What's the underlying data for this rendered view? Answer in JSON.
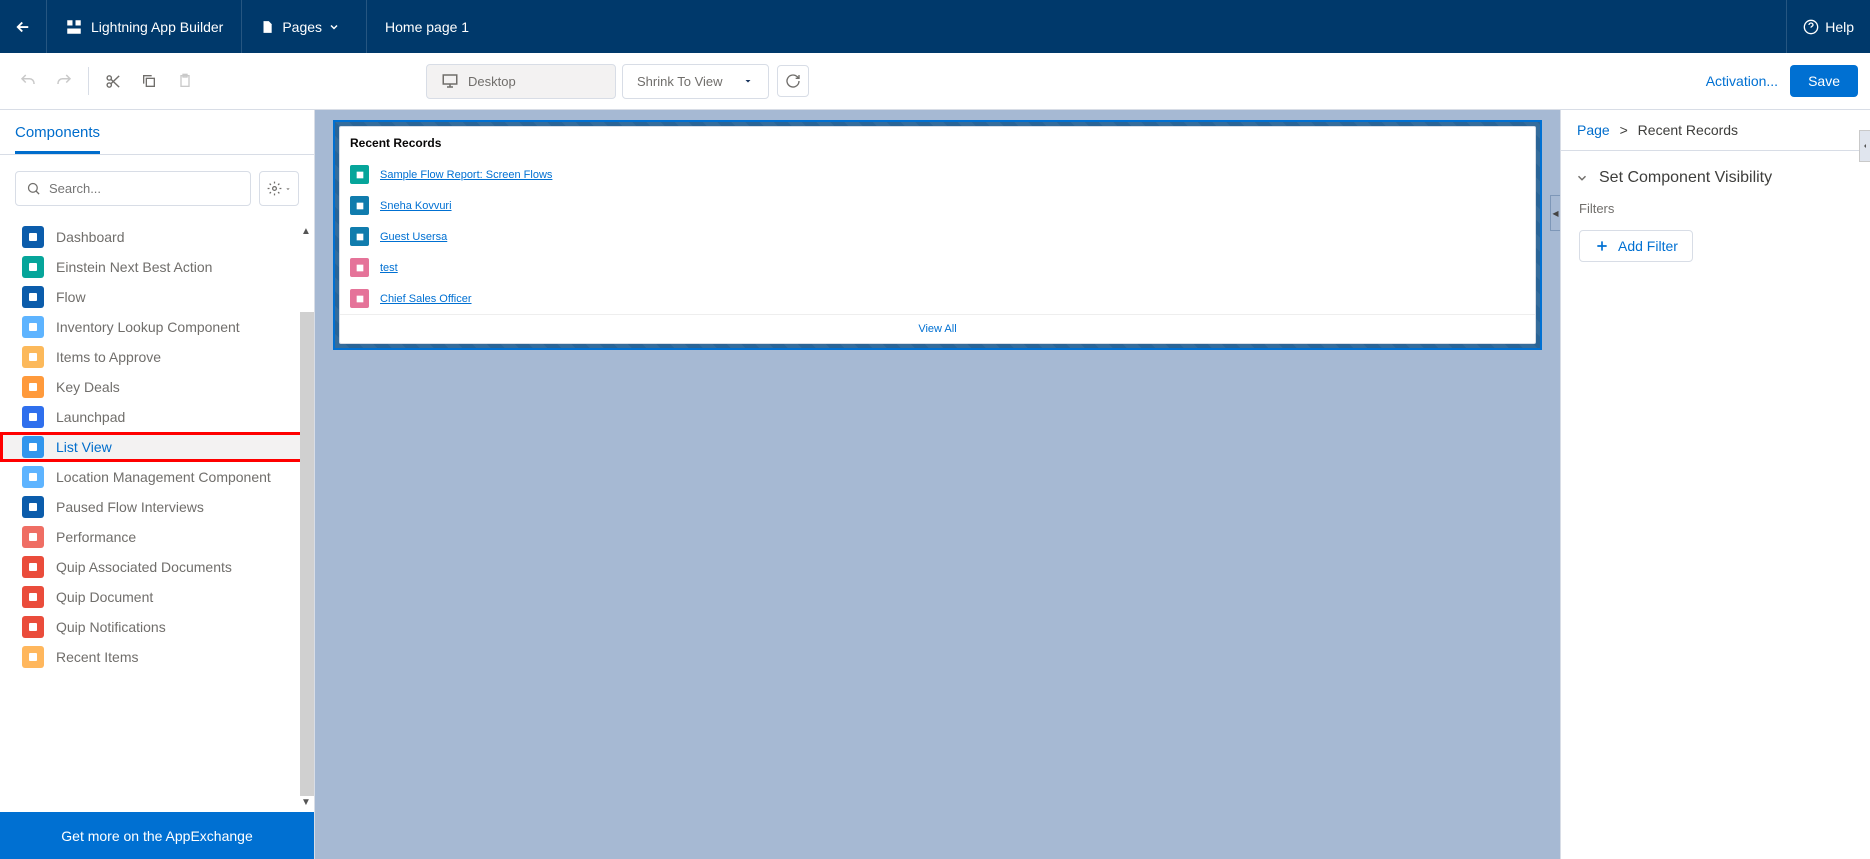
{
  "header": {
    "app_title": "Lightning App Builder",
    "pages_label": "Pages",
    "page_name": "Home page 1",
    "help_label": "Help"
  },
  "toolbar": {
    "device_label": "Desktop",
    "zoom_label": "Shrink To View",
    "activation_label": "Activation...",
    "save_label": "Save"
  },
  "left": {
    "tab_label": "Components",
    "search_placeholder": "Search...",
    "appexchange_label": "Get more on the AppExchange",
    "components": [
      {
        "label": "Dashboard",
        "color": "#0b5cab",
        "highlight": false
      },
      {
        "label": "Einstein Next Best Action",
        "color": "#06a59a",
        "highlight": false
      },
      {
        "label": "Flow",
        "color": "#0b5cab",
        "highlight": false
      },
      {
        "label": "Inventory Lookup Component",
        "color": "#5eb4ff",
        "highlight": false
      },
      {
        "label": "Items to Approve",
        "color": "#fcb95b",
        "highlight": false
      },
      {
        "label": "Key Deals",
        "color": "#ff9a3c",
        "highlight": false
      },
      {
        "label": "Launchpad",
        "color": "#2f6fed",
        "highlight": false
      },
      {
        "label": "List View",
        "color": "#3296ed",
        "highlight": true
      },
      {
        "label": "Location Management Component",
        "color": "#5eb4ff",
        "highlight": false
      },
      {
        "label": "Paused Flow Interviews",
        "color": "#0b5cab",
        "highlight": false
      },
      {
        "label": "Performance",
        "color": "#ef6e64",
        "highlight": false
      },
      {
        "label": "Quip Associated Documents",
        "color": "#ea4c3b",
        "highlight": false
      },
      {
        "label": "Quip Document",
        "color": "#ea4c3b",
        "highlight": false
      },
      {
        "label": "Quip Notifications",
        "color": "#ea4c3b",
        "highlight": false
      },
      {
        "label": "Recent Items",
        "color": "#ffb75d",
        "highlight": false
      }
    ]
  },
  "canvas": {
    "card_title": "Recent Records",
    "view_all": "View All",
    "records": [
      {
        "label": "Sample Flow Report: Screen Flows",
        "color": "#06a59a"
      },
      {
        "label": "Sneha Kovvuri",
        "color": "#107cad"
      },
      {
        "label": "Guest Usersa",
        "color": "#107cad"
      },
      {
        "label": "test",
        "color": "#e57399"
      },
      {
        "label": "Chief Sales Officer",
        "color": "#e57399"
      }
    ]
  },
  "right": {
    "breadcrumb_page": "Page",
    "breadcrumb_current": "Recent Records",
    "section_title": "Set Component Visibility",
    "filters_label": "Filters",
    "add_filter_label": "Add Filter"
  }
}
